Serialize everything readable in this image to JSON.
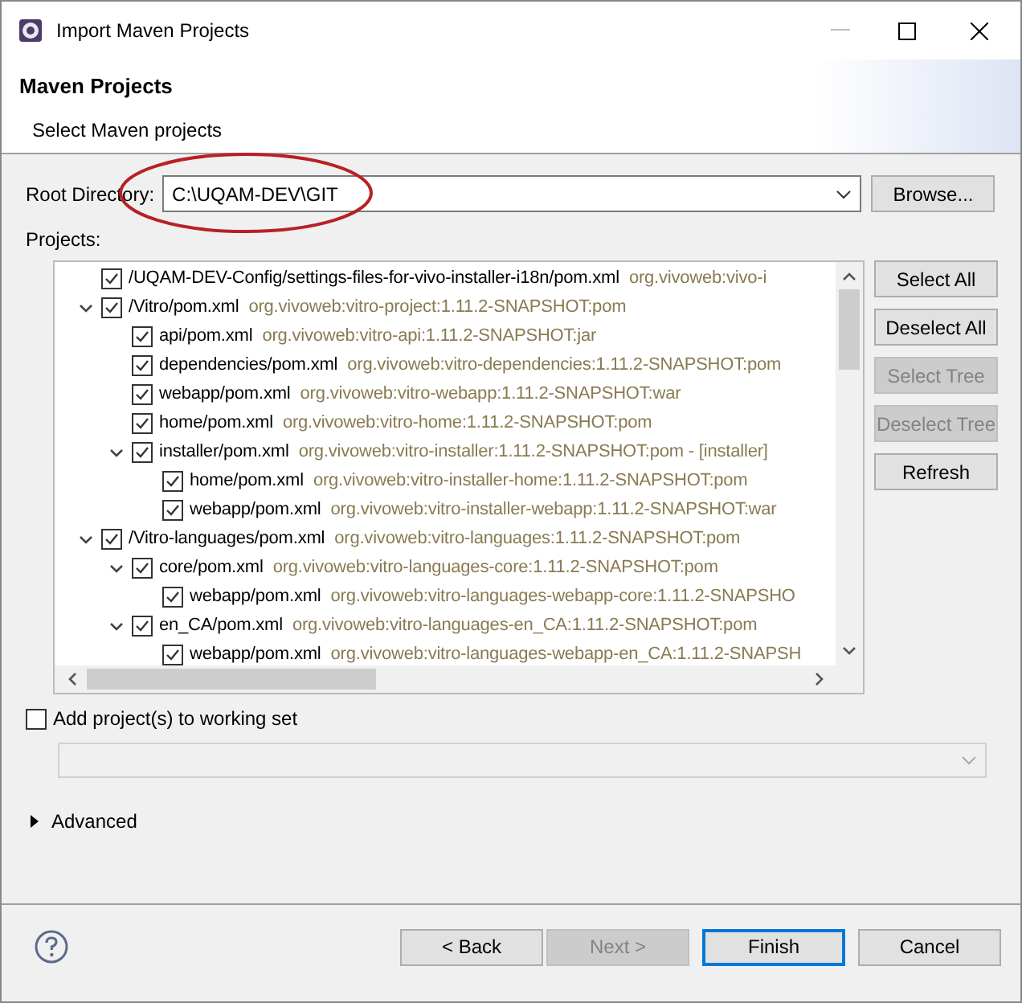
{
  "window": {
    "title": "Import Maven Projects"
  },
  "header": {
    "title": "Maven Projects",
    "subtitle": "Select Maven projects"
  },
  "root_directory": {
    "label": "Root Directory:",
    "value": "C:\\UQAM-DEV\\GIT"
  },
  "browse_button": "Browse...",
  "projects": {
    "label": "Projects:",
    "tree": [
      {
        "name": "/UQAM-DEV-Config/settings-files-for-vivo-installer-i18n/pom.xml",
        "artifact": "org.vivoweb:vivo-i",
        "checked": true
      },
      {
        "name": "/Vitro/pom.xml",
        "artifact": "org.vivoweb:vitro-project:1.11.2-SNAPSHOT:pom",
        "checked": true,
        "expanded": true,
        "children": [
          {
            "name": "api/pom.xml",
            "artifact": "org.vivoweb:vitro-api:1.11.2-SNAPSHOT:jar",
            "checked": true
          },
          {
            "name": "dependencies/pom.xml",
            "artifact": "org.vivoweb:vitro-dependencies:1.11.2-SNAPSHOT:pom",
            "checked": true
          },
          {
            "name": "webapp/pom.xml",
            "artifact": "org.vivoweb:vitro-webapp:1.11.2-SNAPSHOT:war",
            "checked": true
          },
          {
            "name": "home/pom.xml",
            "artifact": "org.vivoweb:vitro-home:1.11.2-SNAPSHOT:pom",
            "checked": true
          },
          {
            "name": "installer/pom.xml",
            "artifact": "org.vivoweb:vitro-installer:1.11.2-SNAPSHOT:pom - [installer]",
            "checked": true,
            "expanded": true,
            "children": [
              {
                "name": "home/pom.xml",
                "artifact": "org.vivoweb:vitro-installer-home:1.11.2-SNAPSHOT:pom",
                "checked": true
              },
              {
                "name": "webapp/pom.xml",
                "artifact": "org.vivoweb:vitro-installer-webapp:1.11.2-SNAPSHOT:war",
                "checked": true
              }
            ]
          }
        ]
      },
      {
        "name": "/Vitro-languages/pom.xml",
        "artifact": "org.vivoweb:vitro-languages:1.11.2-SNAPSHOT:pom",
        "checked": true,
        "expanded": true,
        "children": [
          {
            "name": "core/pom.xml",
            "artifact": "org.vivoweb:vitro-languages-core:1.11.2-SNAPSHOT:pom",
            "checked": true,
            "expanded": true,
            "children": [
              {
                "name": "webapp/pom.xml",
                "artifact": "org.vivoweb:vitro-languages-webapp-core:1.11.2-SNAPSHO",
                "checked": true
              }
            ]
          },
          {
            "name": "en_CA/pom.xml",
            "artifact": "org.vivoweb:vitro-languages-en_CA:1.11.2-SNAPSHOT:pom",
            "checked": true,
            "expanded": true,
            "children": [
              {
                "name": "webapp/pom.xml",
                "artifact": "org.vivoweb:vitro-languages-webapp-en_CA:1.11.2-SNAPSH",
                "checked": true
              }
            ]
          }
        ]
      }
    ]
  },
  "side_buttons": [
    {
      "label": "Select All",
      "disabled": false
    },
    {
      "label": "Deselect All",
      "disabled": false
    },
    {
      "label": "Select Tree",
      "disabled": true
    },
    {
      "label": "Deselect Tree",
      "disabled": true
    },
    {
      "label": "Refresh",
      "disabled": false
    }
  ],
  "working_set": {
    "label": "Add project(s) to working set",
    "checked": false
  },
  "advanced": {
    "label": "Advanced",
    "expanded": false
  },
  "footer_buttons": [
    {
      "label": "< Back",
      "disabled": false,
      "default": false
    },
    {
      "label": "Next >",
      "disabled": true,
      "default": false
    },
    {
      "label": "Finish",
      "disabled": false,
      "default": true
    },
    {
      "label": "Cancel",
      "disabled": false,
      "default": false
    }
  ]
}
